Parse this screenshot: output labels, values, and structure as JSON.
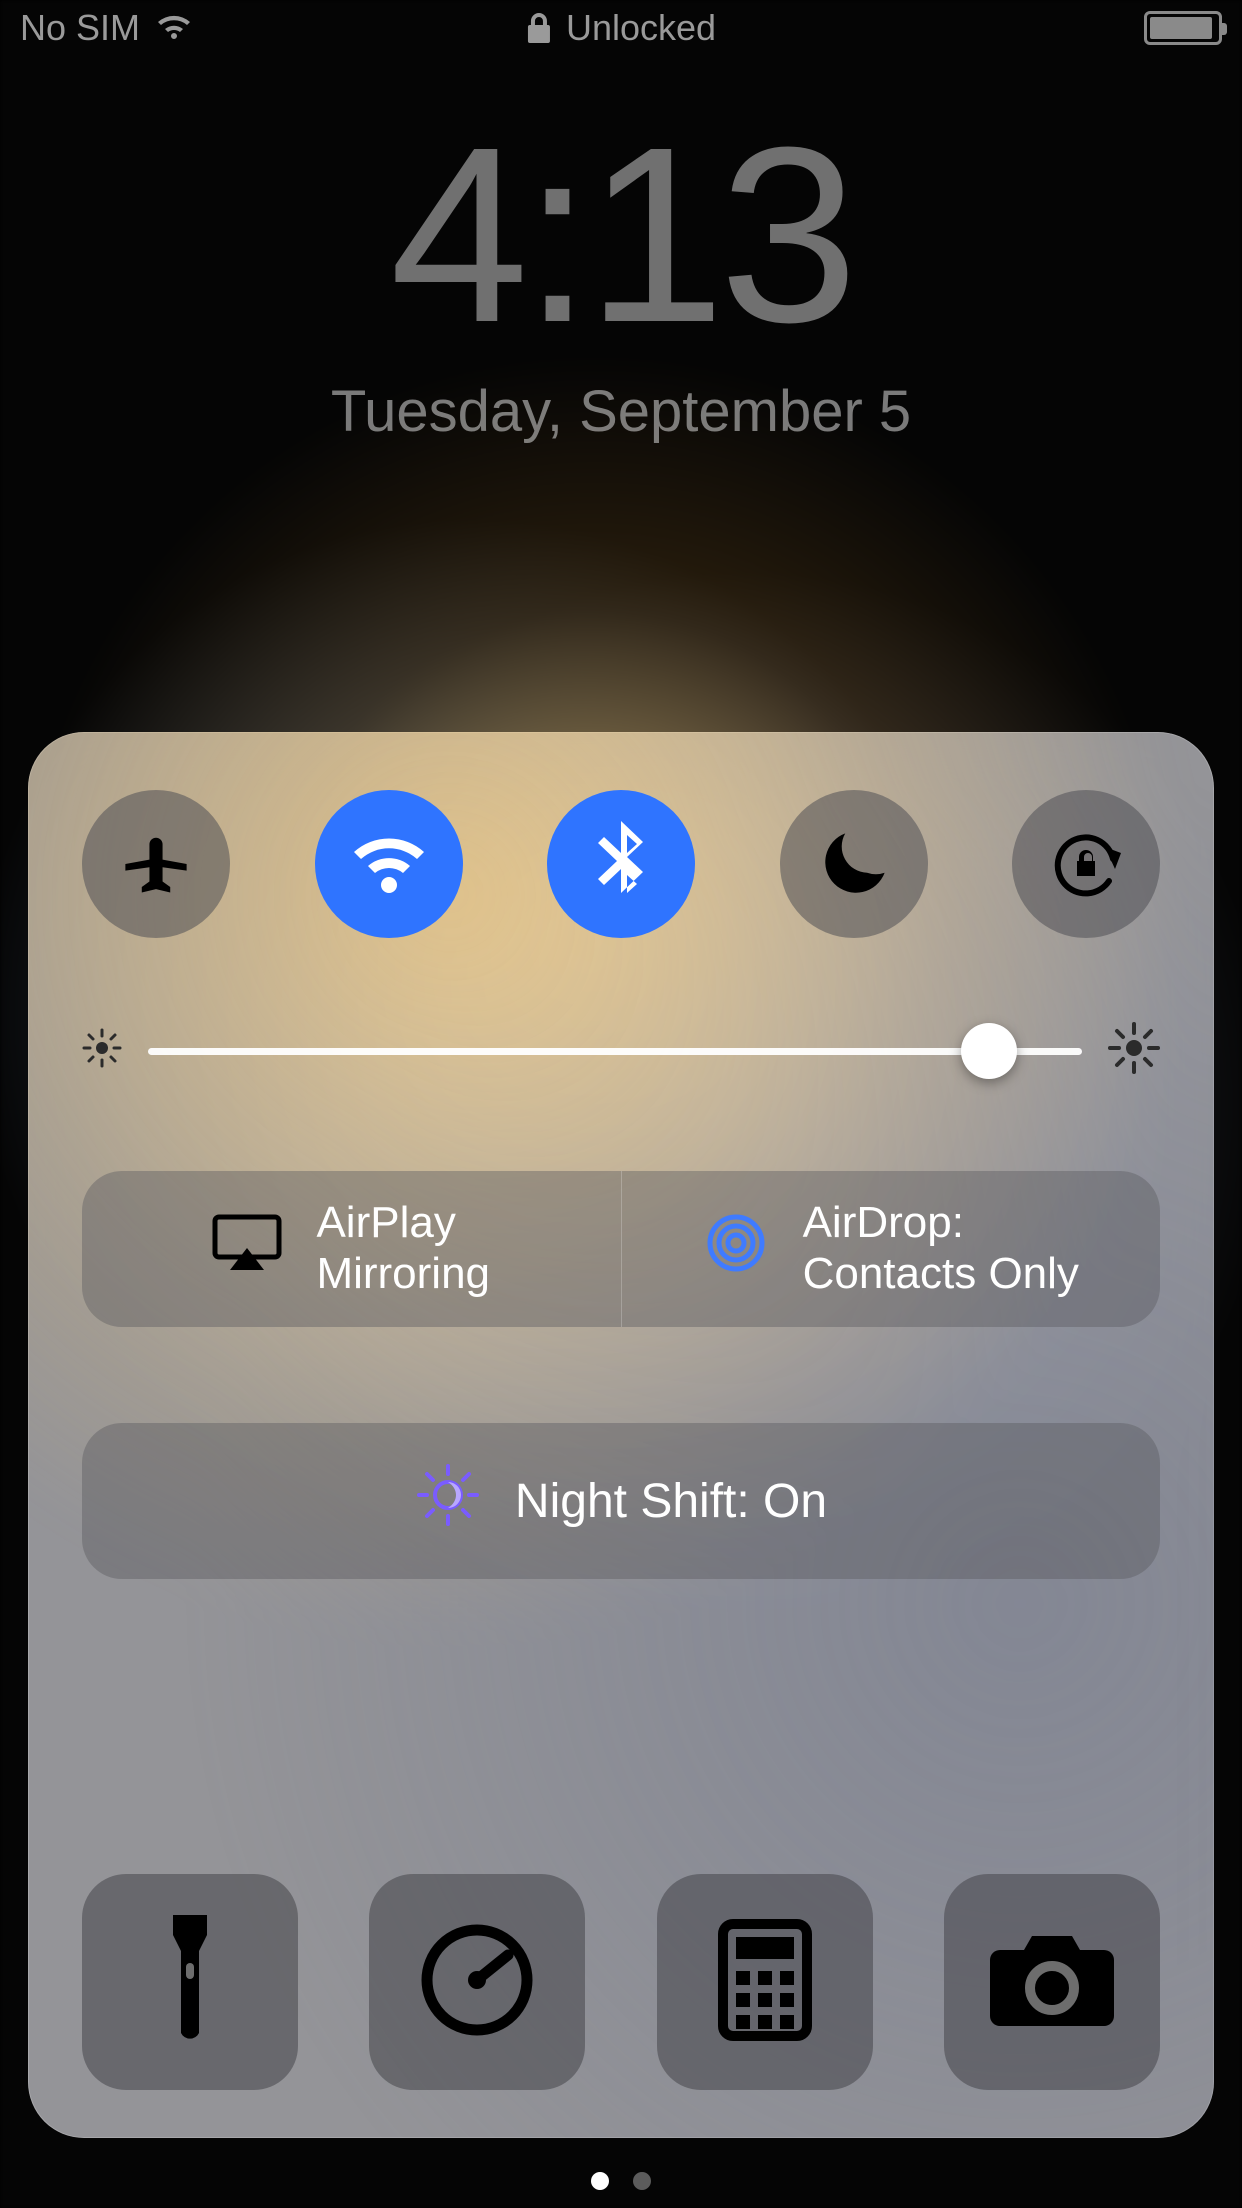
{
  "status": {
    "carrier": "No SIM",
    "lock_text": "Unlocked"
  },
  "clock": {
    "time": "4:13",
    "date": "Tuesday, September 5"
  },
  "brightness": {
    "percent": 90
  },
  "toggles": {
    "airplane": {
      "name": "airplane-mode",
      "on": false
    },
    "wifi": {
      "name": "wifi",
      "on": true
    },
    "bluetooth": {
      "name": "bluetooth",
      "on": true
    },
    "dnd": {
      "name": "do-not-disturb",
      "on": false
    },
    "rotation": {
      "name": "rotation-lock",
      "on": false
    }
  },
  "airplay": {
    "label_line1": "AirPlay",
    "label_line2": "Mirroring"
  },
  "airdrop": {
    "label_line1": "AirDrop:",
    "label_line2": "Contacts Only"
  },
  "night_shift": {
    "label": "Night Shift: On"
  },
  "shortcuts": {
    "flashlight": "flashlight",
    "timer": "timer",
    "calculator": "calculator",
    "camera": "camera"
  },
  "pager": {
    "count": 2,
    "active": 0
  }
}
